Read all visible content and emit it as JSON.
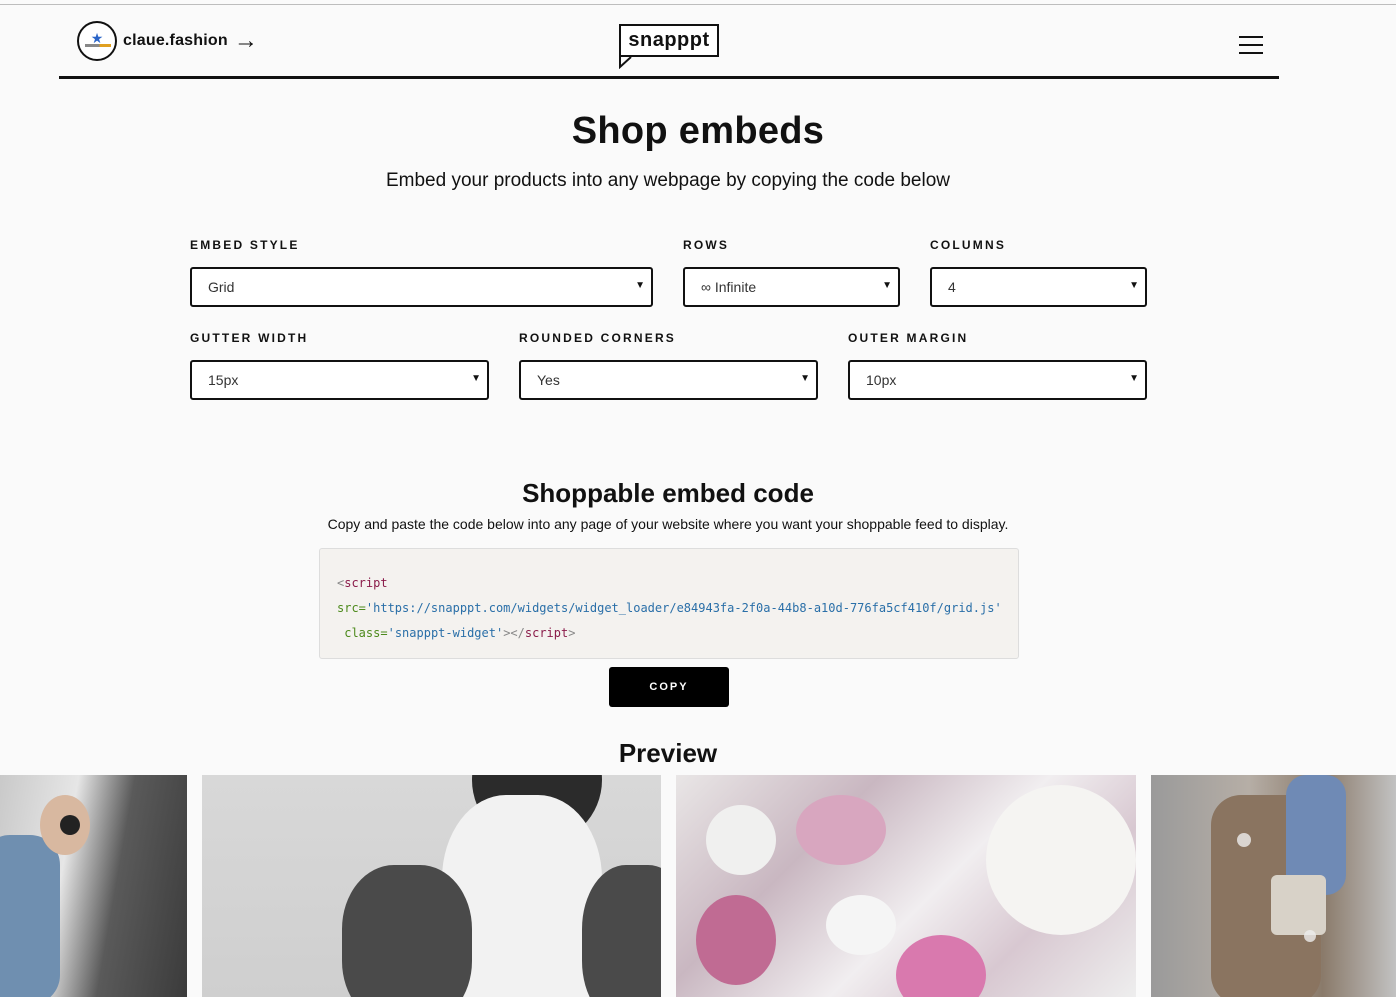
{
  "header": {
    "brand_name": "claue.fashion",
    "brand_arrow": "→",
    "logo_text": "snapppt"
  },
  "page": {
    "title": "Shop embeds",
    "subtitle": "Embed your products into any webpage by copying the code below"
  },
  "form": {
    "embed_style": {
      "label": "EMBED STYLE",
      "value": "Grid"
    },
    "rows": {
      "label": "ROWS",
      "value": "∞ Infinite"
    },
    "columns": {
      "label": "COLUMNS",
      "value": "4"
    },
    "gutter_width": {
      "label": "GUTTER WIDTH",
      "value": "15px"
    },
    "rounded_corners": {
      "label": "ROUNDED CORNERS",
      "value": "Yes"
    },
    "outer_margin": {
      "label": "OUTER MARGIN",
      "value": "10px"
    },
    "caret": "▼"
  },
  "embed": {
    "title": "Shoppable embed code",
    "subtitle": "Copy and paste the code below into any page of your website where you want your shoppable feed to display.",
    "code": {
      "open_lt": "<",
      "tag": "script",
      "src_attr": "src=",
      "src_value": "'https://snapppt.com/widgets/widget_loader/e84943fa-2f0a-44b8-a10d-776fa5cf410f/grid.js'",
      "class_attr": "class=",
      "class_value": "'snapppt-widget'",
      "close": "></",
      "close_gt": ">"
    },
    "copy_label": "COPY"
  },
  "preview": {
    "title": "Preview"
  }
}
